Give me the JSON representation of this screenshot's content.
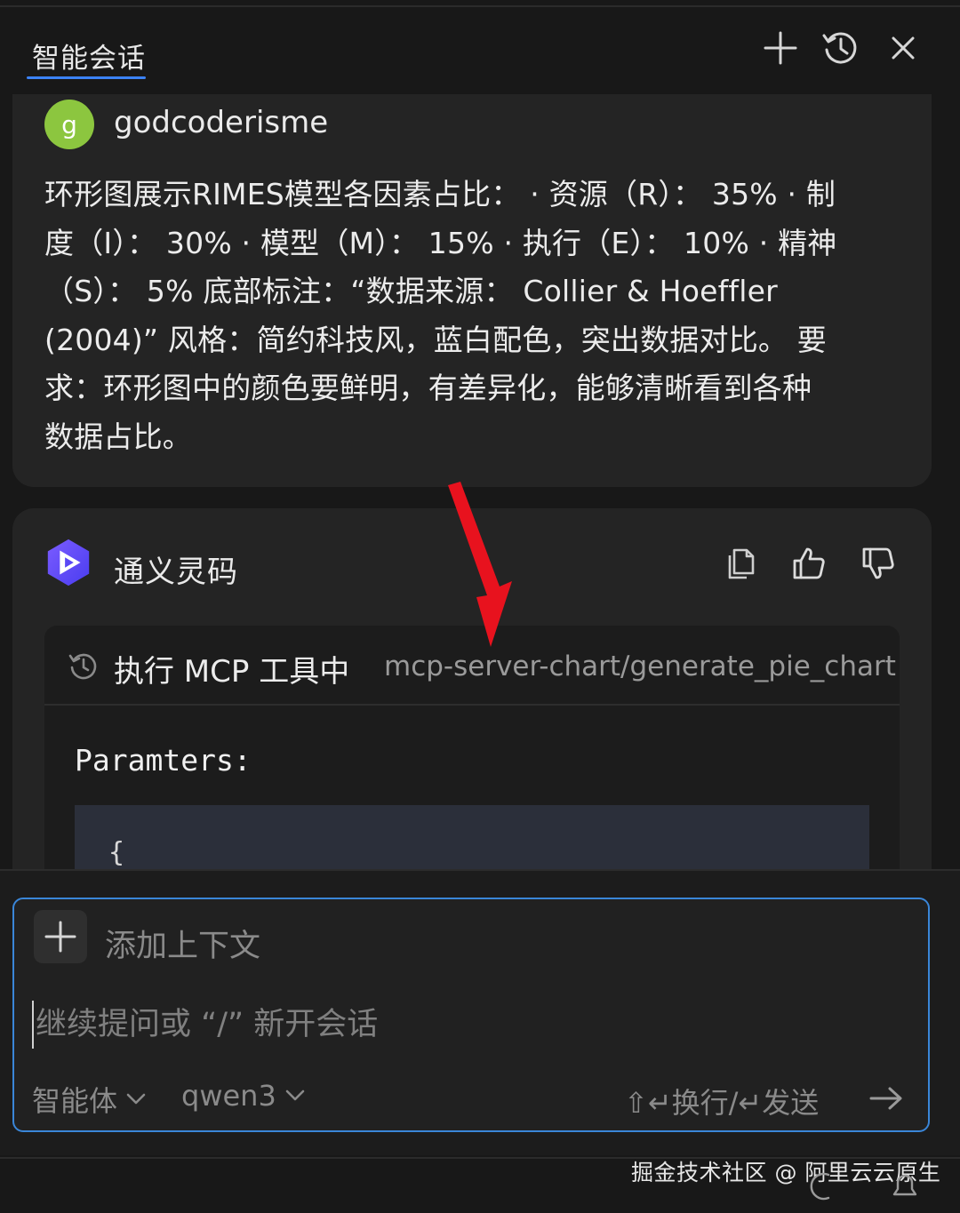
{
  "header": {
    "tab_title": "智能会话",
    "actions": [
      {
        "icon": "plus-icon",
        "label": "new-chat"
      },
      {
        "icon": "history-icon",
        "label": "history"
      },
      {
        "icon": "close-icon",
        "label": "close"
      }
    ]
  },
  "user_message": {
    "avatar_letter": "g",
    "avatar_color": "#8cc63f",
    "username": "godcoderisme",
    "lines": [
      "环形图展示RIMES模型各因素占比： · 资源（R）： 35% · 制",
      "度（I）： 30% · 模型（M）： 15% · 执行（E）： 10% · 精神",
      "（S）： 5% 底部标注：“数据来源： Collier & Hoeffler",
      "(2004)” 风格：简约科技风，蓝白配色，突出数据对比。 要",
      "求：环形图中的颜色要鲜明，有差异化，能够清晰看到各种",
      "数据占比。"
    ]
  },
  "assistant_message": {
    "name": "通义灵码",
    "actions": [
      "copy-icon",
      "thumbs-up-icon",
      "thumbs-down-icon"
    ],
    "tool_call": {
      "status_label": "执行 MCP 工具中",
      "tool_name": "mcp-server-chart/generate_pie_chart",
      "params_title": "Paramters:",
      "code_preview": "{"
    }
  },
  "input": {
    "add_context_label": "添加上下文",
    "placeholder": "继续提问或 “/” 新开会话",
    "agent_selector": "智能体",
    "model_selector": "qwen3",
    "hint": "⇧↵换行/↵发送"
  },
  "watermark": "掘金技术社区 @ 阿里云云原生",
  "colors": {
    "accent": "#3a86d8",
    "tab_underline": "#3b82f6",
    "annotation_arrow": "#e8121e"
  }
}
